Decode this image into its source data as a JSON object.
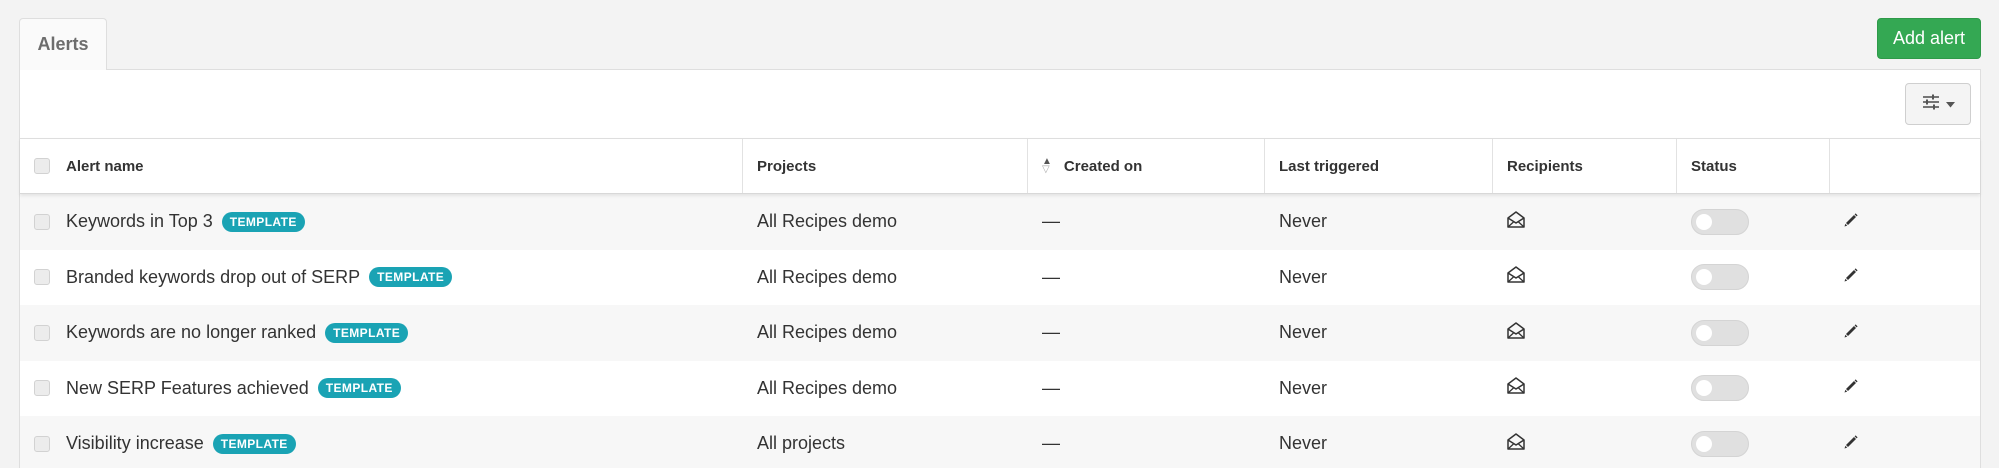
{
  "tabs": [
    {
      "label": "Alerts"
    }
  ],
  "toolbar": {
    "add_alert_label": "Add alert"
  },
  "table": {
    "columns": [
      "Alert name",
      "Projects",
      "Created on",
      "Last triggered",
      "Recipients",
      "Status",
      ""
    ],
    "rows": [
      {
        "name": "Keywords in Top 3",
        "badge": "TEMPLATE",
        "project": "All Recipes demo",
        "created": "—",
        "last_triggered": "Never",
        "status": "off"
      },
      {
        "name": "Branded keywords drop out of SERP",
        "badge": "TEMPLATE",
        "project": "All Recipes demo",
        "created": "—",
        "last_triggered": "Never",
        "status": "off"
      },
      {
        "name": "Keywords are no longer ranked",
        "badge": "TEMPLATE",
        "project": "All Recipes demo",
        "created": "—",
        "last_triggered": "Never",
        "status": "off"
      },
      {
        "name": "New SERP Features achieved",
        "badge": "TEMPLATE",
        "project": "All Recipes demo",
        "created": "—",
        "last_triggered": "Never",
        "status": "off"
      },
      {
        "name": "Visibility increase",
        "badge": "TEMPLATE",
        "project": "All projects",
        "created": "—",
        "last_triggered": "Never",
        "status": "off"
      }
    ]
  },
  "icons": {
    "recipients": "envelope-open-icon",
    "edit": "pencil-icon",
    "settings": "sliders-icon",
    "sort": "sort-arrows-icon"
  },
  "colors": {
    "accent_green": "#34a853",
    "badge_teal": "#1aa3b4",
    "toggle_off": "#e0e0e0"
  }
}
